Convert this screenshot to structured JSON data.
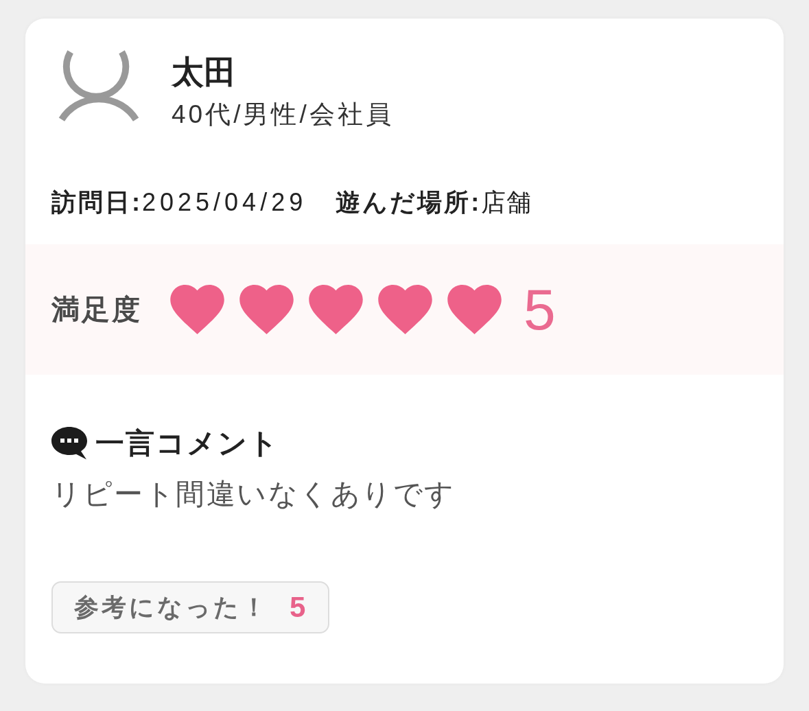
{
  "reviewer": {
    "name": "太田",
    "profile": "40代/男性/会社員"
  },
  "visit": [
    {
      "label": "訪問日:",
      "value": "2025/04/29"
    },
    {
      "label": "遊んだ場所:",
      "value": "店舗"
    }
  ],
  "satisfaction": {
    "label": "満足度",
    "stars": 5,
    "score": "5"
  },
  "comment": {
    "heading": "一言コメント",
    "text": "リピート間違いなくありです"
  },
  "helpful_button": {
    "label": "参考になった！",
    "count": "5"
  }
}
